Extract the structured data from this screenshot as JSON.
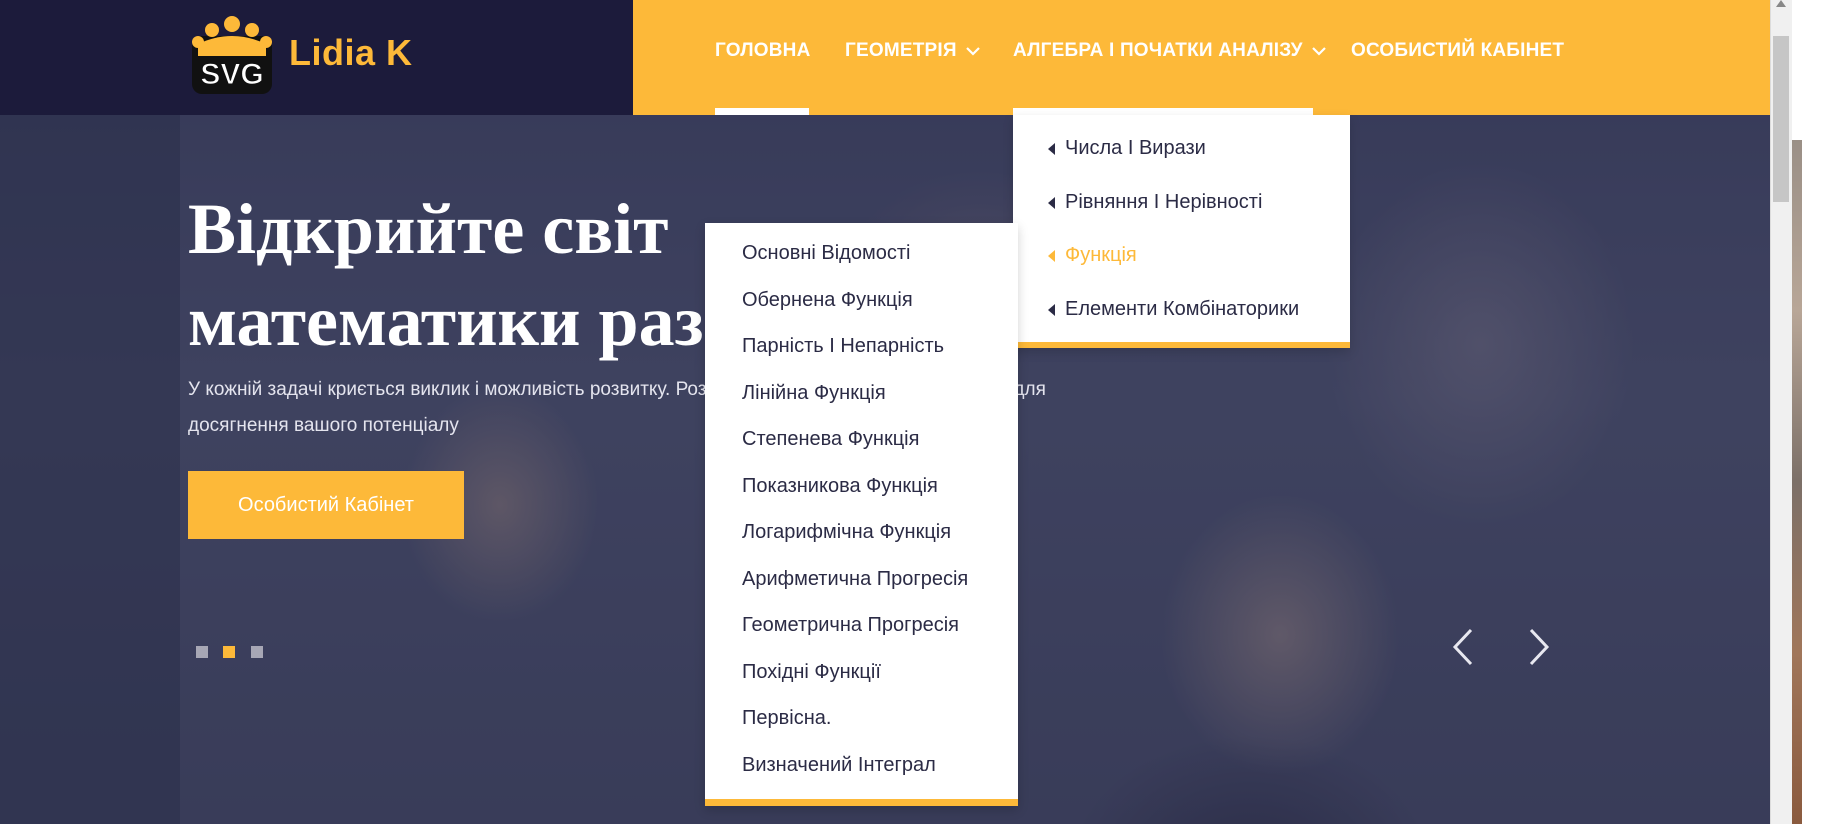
{
  "brand": {
    "logo_text": "SVG",
    "name": "Lidia K"
  },
  "nav": {
    "items": [
      {
        "label": "ГОЛОВНА"
      },
      {
        "label": "ГЕОМЕТРІЯ"
      },
      {
        "label": "АЛГЕБРА І ПОЧАТКИ АНАЛІЗУ"
      },
      {
        "label": "ОСОБИСТИЙ КАБІНЕТ"
      }
    ]
  },
  "algebra_submenu": {
    "items": [
      {
        "label": "Числа І Вирази"
      },
      {
        "label": "Рівняння І Нерівності"
      },
      {
        "label": "Функція"
      },
      {
        "label": "Елементи Комбінаторики"
      }
    ],
    "active_index": 2
  },
  "function_submenu": {
    "items": [
      "Основні Відомості",
      "Обернена Функція",
      "Парність І Непарність",
      "Лінійна Функція",
      "Степенева Функція",
      "Показникова Функція",
      "Логарифмічна Функція",
      "Арифметична Прогресія",
      "Геометрична Прогресія",
      "Похідні Функції",
      "Первісна.",
      "Визначений Інтеграл"
    ]
  },
  "hero": {
    "title_line1": "Відкрийте світ",
    "title_line2": "математики раз",
    "subtitle_line1": "У кожній задачі криється виклик і можливість розвитку. Розг",
    "subtitle_tail": "для",
    "subtitle_line2": "досягнення вашого потенціалу",
    "button_label": "Особистий Кабінет",
    "slides": 3,
    "active_slide": 2
  },
  "colors": {
    "accent": "#fdb939",
    "dark": "#1c1b3b",
    "text": "#2b2b45"
  },
  "icons": [
    "logo-crown-icon",
    "chevron-down-icon",
    "caret-left-icon",
    "arrow-left-icon",
    "arrow-right-icon"
  ]
}
